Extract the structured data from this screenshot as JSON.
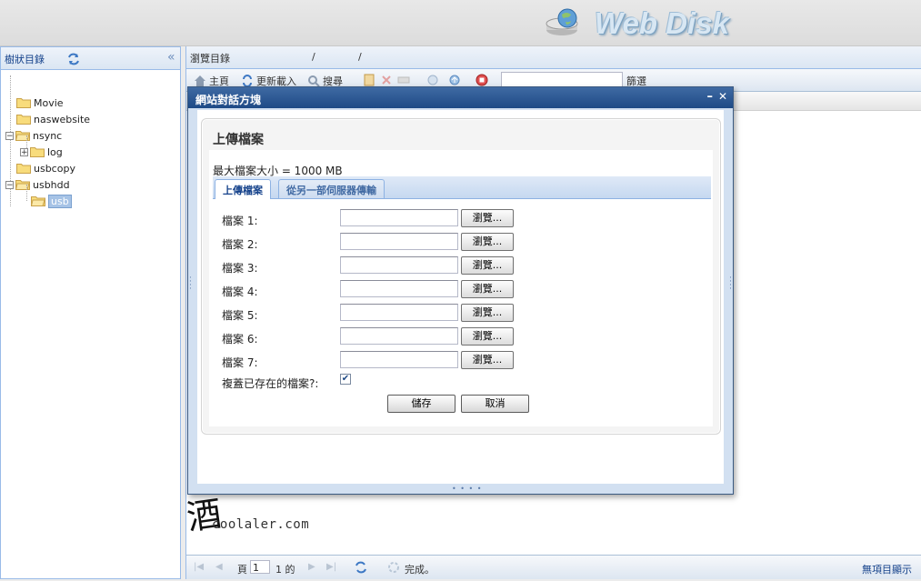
{
  "header": {
    "brand": "Web Disk"
  },
  "tree": {
    "title": "樹狀目錄",
    "items": [
      {
        "label": "Movie"
      },
      {
        "label": "naswebsite"
      },
      {
        "label": "nsync"
      },
      {
        "label": "log"
      },
      {
        "label": "usbcopy"
      },
      {
        "label": "usbhdd"
      },
      {
        "label": "usb"
      }
    ]
  },
  "browser": {
    "title": "瀏覽目錄",
    "sep1": "/",
    "sep2": "/",
    "toolbar": {
      "home": "主頁",
      "reload": "更新載入",
      "search": "搜尋",
      "filter": "篩選"
    }
  },
  "pager": {
    "page_label": "頁",
    "page_value": "1",
    "of_label": "1 的",
    "status": "完成。",
    "right_status": "無項目顯示"
  },
  "dialog": {
    "title": "網站對話方塊",
    "section_title": "上傳檔案",
    "max_size": "最大檔案大小 = 1000 MB",
    "tabs": [
      {
        "label": "上傳檔案",
        "active": true
      },
      {
        "label": "從另一部伺服器傳輸",
        "active": false
      }
    ],
    "files": [
      {
        "label": "檔案 1:",
        "browse": "瀏覽..."
      },
      {
        "label": "檔案 2:",
        "browse": "瀏覽..."
      },
      {
        "label": "檔案 3:",
        "browse": "瀏覽..."
      },
      {
        "label": "檔案 4:",
        "browse": "瀏覽..."
      },
      {
        "label": "檔案 5:",
        "browse": "瀏覽..."
      },
      {
        "label": "檔案 6:",
        "browse": "瀏覽..."
      },
      {
        "label": "檔案 7:",
        "browse": "瀏覽..."
      }
    ],
    "overwrite_label": "複蓋已存在的檔案?:",
    "overwrite_checked": true,
    "save": "儲存",
    "cancel": "取消"
  },
  "watermark": {
    "signature": "酒",
    "site": "coolaler.com"
  }
}
